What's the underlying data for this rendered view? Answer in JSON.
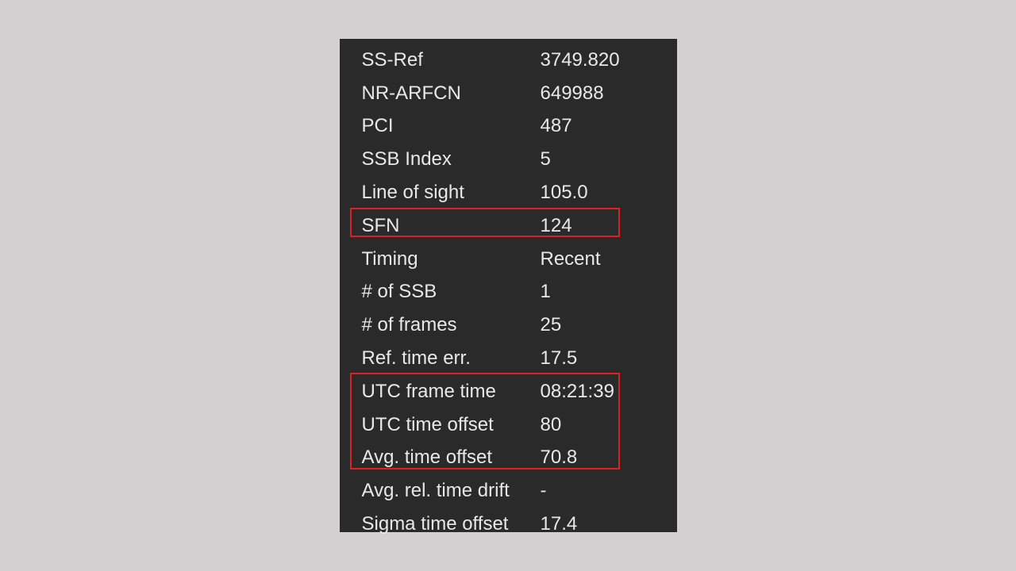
{
  "rows": [
    {
      "label": "SS-Ref",
      "value": "3749.820"
    },
    {
      "label": "NR-ARFCN",
      "value": "649988"
    },
    {
      "label": "PCI",
      "value": "487"
    },
    {
      "label": "SSB Index",
      "value": "5"
    },
    {
      "label": "Line of sight",
      "value": "105.0"
    },
    {
      "label": "SFN",
      "value": "124"
    },
    {
      "label": "Timing",
      "value": "Recent"
    },
    {
      "label": "# of SSB",
      "value": "1"
    },
    {
      "label": "# of frames",
      "value": "25"
    },
    {
      "label": "Ref. time err.",
      "value": "17.5"
    },
    {
      "label": "UTC frame time",
      "value": "08:21:39"
    },
    {
      "label": "UTC time offset",
      "value": "80"
    },
    {
      "label": "Avg. time offset",
      "value": "70.8"
    },
    {
      "label": "Avg. rel. time drift",
      "value": "-"
    },
    {
      "label": "Sigma time offset",
      "value": "17.4"
    }
  ]
}
